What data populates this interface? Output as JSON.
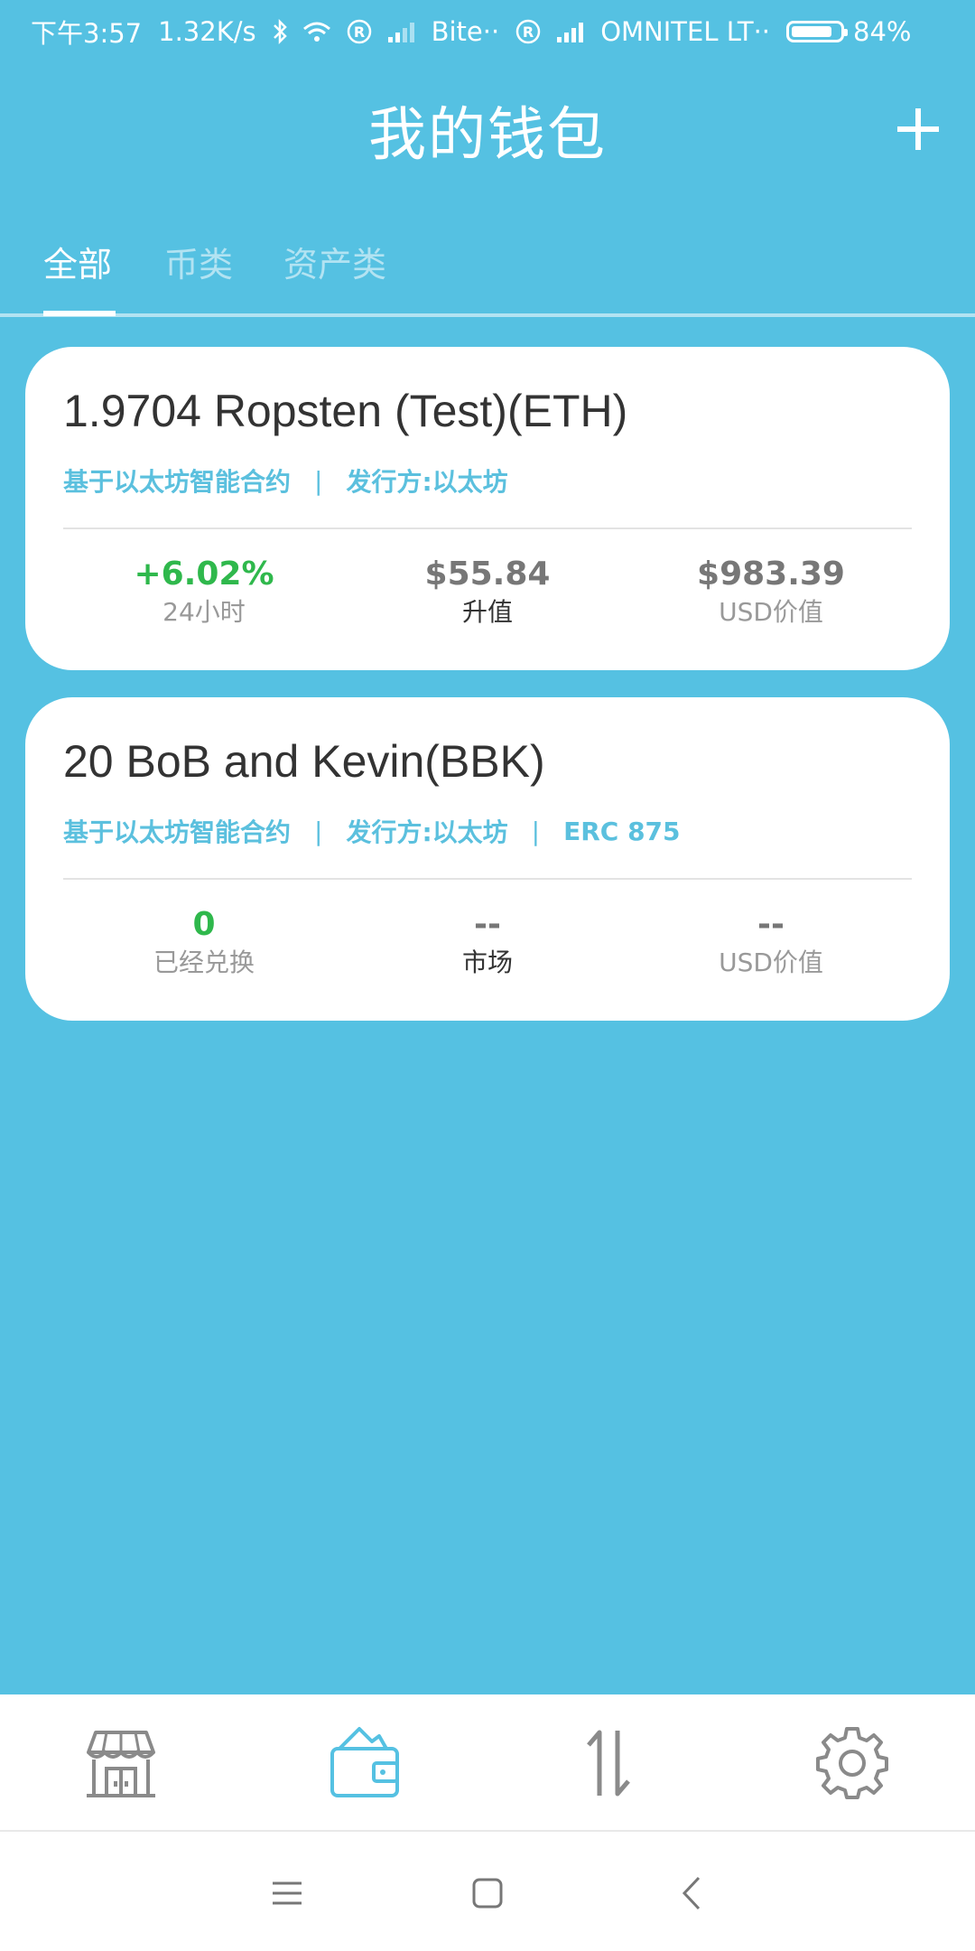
{
  "status_bar": {
    "time": "下午3:57",
    "speed": "1.32K/s",
    "carrier1": "Bite··",
    "carrier2": "OMNITEL LT··",
    "battery": "84%",
    "battery_level": 0.84
  },
  "header": {
    "title": "我的钱包",
    "add_icon": "plus-icon"
  },
  "tabs": [
    {
      "label": "全部",
      "active": true
    },
    {
      "label": "币类",
      "active": false
    },
    {
      "label": "资产类",
      "active": false
    }
  ],
  "cards": [
    {
      "name": "1.9704 Ropsten (Test)(ETH)",
      "meta": [
        "基于以太坊智能合约",
        "发行方:以太坊"
      ],
      "stats": [
        {
          "value": "+6.02%",
          "label": "24小时"
        },
        {
          "value": "$55.84",
          "label": "升值"
        },
        {
          "value": "$983.39",
          "label": "USD价值"
        }
      ]
    },
    {
      "name": "20 BoB and Kevin(BBK)",
      "meta": [
        "基于以太坊智能合约",
        "发行方:以太坊",
        "ERC 875"
      ],
      "stats": [
        {
          "value": "0",
          "label": "已经兑换"
        },
        {
          "value": "--",
          "label": "市场"
        },
        {
          "value": "--",
          "label": "USD价值"
        }
      ]
    }
  ],
  "meta_separator": "|",
  "bottom_nav": [
    {
      "icon": "store-icon",
      "active": false
    },
    {
      "icon": "wallet-icon",
      "active": true
    },
    {
      "icon": "transfer-icon",
      "active": false
    },
    {
      "icon": "settings-icon",
      "active": false
    }
  ],
  "system_nav": [
    "menu-icon",
    "home-icon",
    "back-icon"
  ],
  "colors": {
    "background": "#55c1e2",
    "accent": "#5bc0de",
    "positive": "#2fb84c",
    "nav_inactive": "#8a8a8a"
  }
}
